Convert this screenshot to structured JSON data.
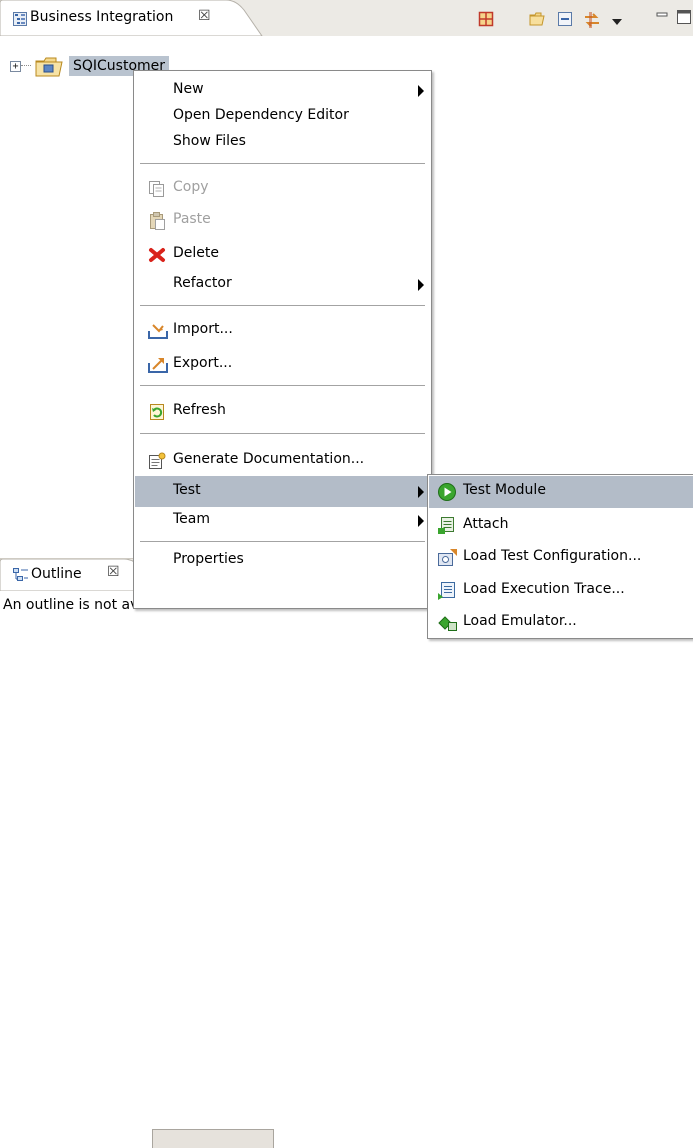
{
  "views": {
    "business_integration": {
      "tab_label": "Business Integration",
      "tab_close": "☒",
      "tree": {
        "expander": "+",
        "root_label": "SQICustomer"
      }
    },
    "outline": {
      "tab_label": "Outline",
      "tab_close": "☒",
      "message": "An outline is not available."
    }
  },
  "toolbar_icons": [
    "grid-icon",
    "open-folder-icon",
    "collapse-icon",
    "link-with-editor-icon",
    "view-menu-icon",
    "minimize-icon",
    "maximize-icon"
  ],
  "context_menu": {
    "items": [
      {
        "label": "New",
        "submenu": true
      },
      {
        "label": "Open Dependency Editor"
      },
      {
        "label": "Show Files"
      },
      {
        "label": "Copy",
        "icon": "copy-icon",
        "disabled": true
      },
      {
        "label": "Paste",
        "icon": "paste-icon",
        "disabled": true
      },
      {
        "label": "Delete",
        "icon": "delete-icon"
      },
      {
        "label": "Refactor",
        "submenu": true
      },
      {
        "label": "Import...",
        "icon": "import-icon"
      },
      {
        "label": "Export...",
        "icon": "export-icon"
      },
      {
        "label": "Refresh",
        "icon": "refresh-icon"
      },
      {
        "label": "Generate Documentation...",
        "icon": "generate-documentation-icon"
      },
      {
        "label": "Test",
        "submenu": true,
        "highlighted": true
      },
      {
        "label": "Team",
        "submenu": true
      },
      {
        "label": "Properties"
      }
    ]
  },
  "test_submenu": {
    "items": [
      {
        "label": "Test Module",
        "icon": "run-icon",
        "highlighted": true
      },
      {
        "label": "Attach",
        "icon": "attach-icon"
      },
      {
        "label": "Load Test Configuration...",
        "icon": "load-test-configuration-icon"
      },
      {
        "label": "Load Execution Trace...",
        "icon": "load-execution-trace-icon"
      },
      {
        "label": "Load Emulator...",
        "icon": "load-emulator-icon"
      }
    ]
  },
  "colors": {
    "highlight": "#b3bcc8",
    "selection": "#b9c3cf",
    "tabbar": "#eceae5",
    "disabled_text": "#a0a0a0",
    "delete_red": "#d9221a",
    "run_green": "#3aa52e"
  }
}
